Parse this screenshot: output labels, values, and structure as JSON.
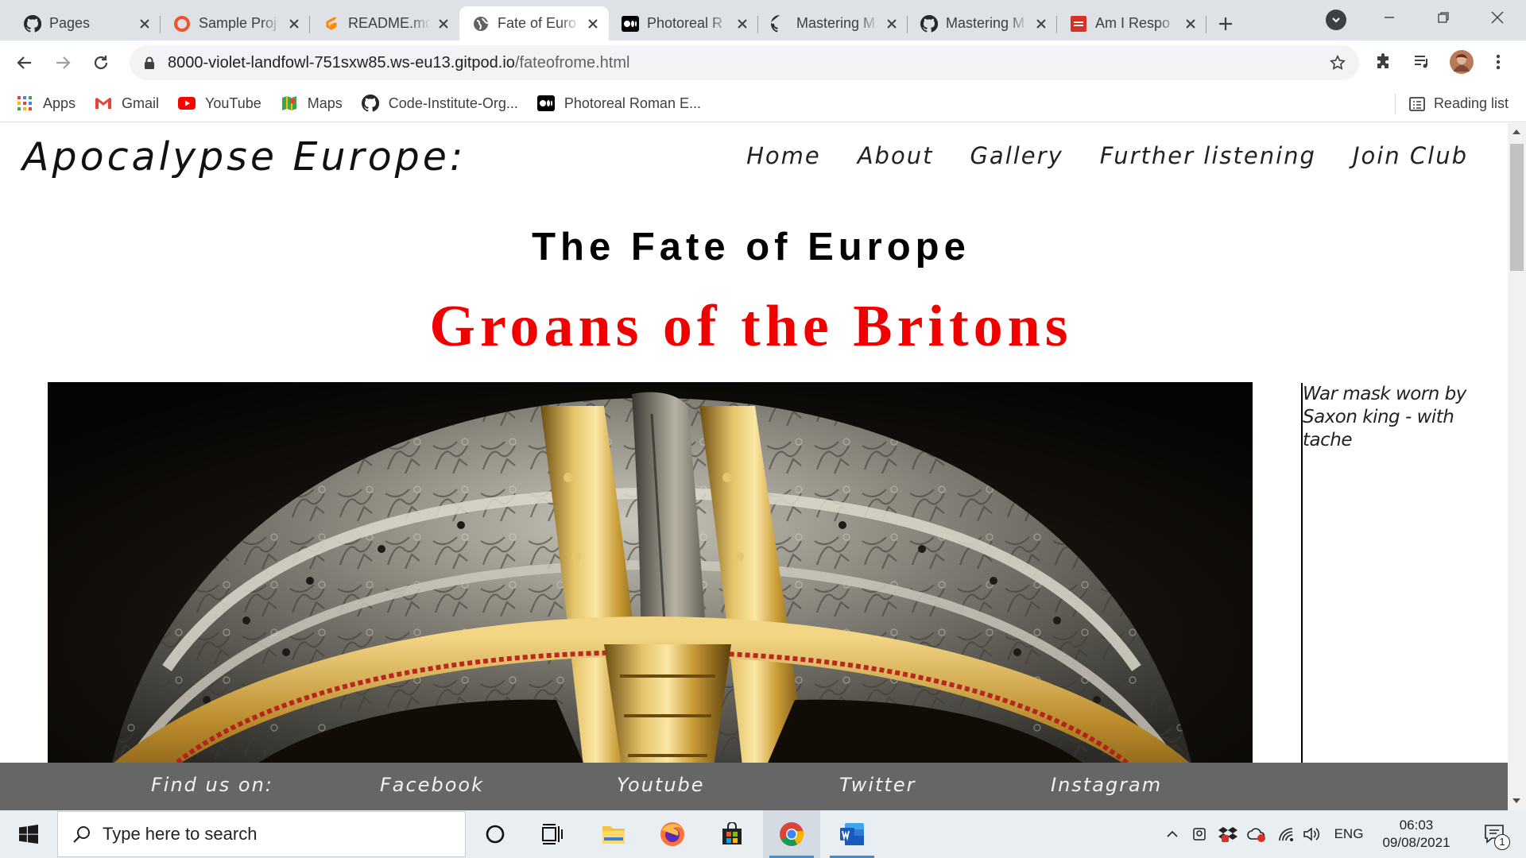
{
  "browser": {
    "tabs": [
      {
        "title": "Pages",
        "icon": "github-icon"
      },
      {
        "title": "Sample Proj",
        "icon": "circle-o-icon"
      },
      {
        "title": "README.md",
        "icon": "gitpod-icon"
      },
      {
        "title": "Fate of Euro",
        "icon": "globe-icon",
        "active": true
      },
      {
        "title": "Photoreal R",
        "icon": "medium-icon"
      },
      {
        "title": "Mastering M",
        "icon": "github-icon"
      },
      {
        "title": "Mastering M",
        "icon": "github-icon"
      },
      {
        "title": "Am I Respo",
        "icon": "am-i-responsive-icon"
      }
    ],
    "url": {
      "host": "8000-violet-landfowl-751sxw85.ws-eu13.gitpod.io",
      "path": "/fateofrome.html"
    },
    "bookmarks": [
      {
        "label": "Apps",
        "icon": "apps-grid-icon"
      },
      {
        "label": "Gmail",
        "icon": "gmail-icon"
      },
      {
        "label": "YouTube",
        "icon": "youtube-icon"
      },
      {
        "label": "Maps",
        "icon": "maps-icon"
      },
      {
        "label": "Code-Institute-Org...",
        "icon": "github-icon"
      },
      {
        "label": "Photoreal Roman E...",
        "icon": "medium-icon"
      }
    ],
    "reading_list": "Reading list"
  },
  "page": {
    "site_title": "Apocalypse Europe:",
    "nav": [
      "Home",
      "About",
      "Gallery",
      "Further listening",
      "Join Club"
    ],
    "heading": "The Fate of Europe",
    "subheading": "Groans of the Britons",
    "caption": [
      "War mask worn by",
      "Saxon king - with tache"
    ],
    "hero_image": "helmet-image",
    "footer": {
      "label": "Find us on:",
      "links": [
        "Facebook",
        "Youtube",
        "Twitter",
        "Instagram"
      ]
    }
  },
  "taskbar": {
    "search_placeholder": "Type here to search",
    "language": "ENG",
    "time": "06:03",
    "date": "09/08/2021",
    "notification_count": "1"
  },
  "colors": {
    "accent_red": "#f20000",
    "footer_bg": "#666666"
  }
}
